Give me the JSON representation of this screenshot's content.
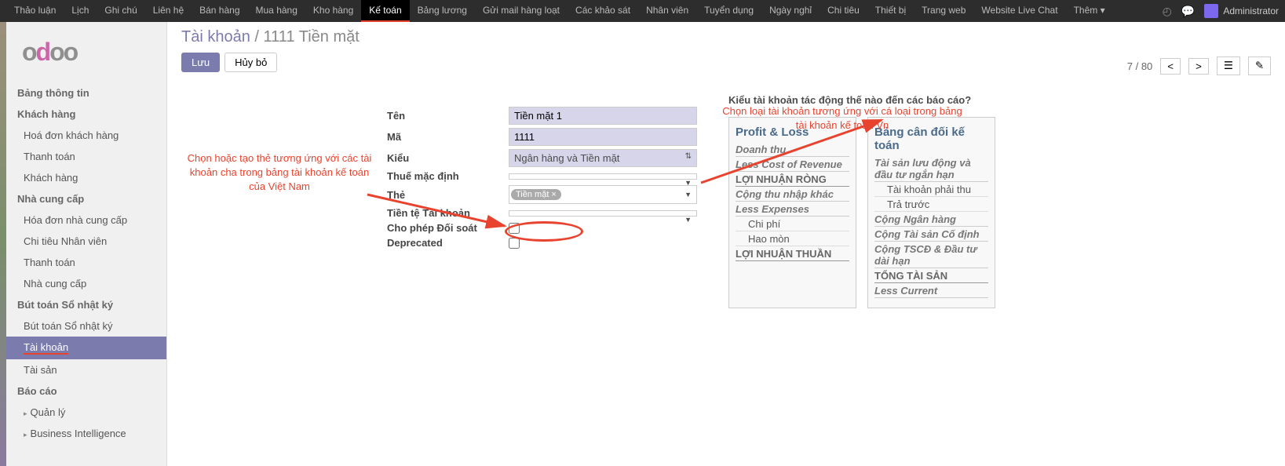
{
  "topbar": {
    "items": [
      "Thảo luận",
      "Lịch",
      "Ghi chú",
      "Liên hệ",
      "Bán hàng",
      "Mua hàng",
      "Kho hàng",
      "Kế toán",
      "Bảng lương",
      "Gửi mail hàng loạt",
      "Các khảo sát",
      "Nhân viên",
      "Tuyển dụng",
      "Ngày nghỉ",
      "Chi tiêu",
      "Thiết bị",
      "Trang web",
      "Website Live Chat",
      "Thêm"
    ],
    "active_index": 7,
    "user": "Administrator"
  },
  "sidebar": {
    "sections": [
      {
        "title": "Bảng thông tin",
        "items": []
      },
      {
        "title": "Khách hàng",
        "items": [
          "Hoá đơn khách hàng",
          "Thanh toán",
          "Khách hàng"
        ]
      },
      {
        "title": "Nhà cung cấp",
        "items": [
          "Hóa đơn nhà cung cấp",
          "Chi tiêu Nhân viên",
          "Thanh toán",
          "Nhà cung cấp"
        ]
      },
      {
        "title": "Bút toán Sổ nhật ký",
        "items": [
          "Bút toán Sổ nhật ký",
          "Tài khoản",
          "Tài sản"
        ],
        "active_index": 1
      },
      {
        "title": "Báo cáo",
        "items": [
          "Quản lý",
          "Business Intelligence"
        ],
        "collapsible": true
      }
    ]
  },
  "breadcrumb": {
    "root": "Tài khoản",
    "current": "1111 Tiền mặt"
  },
  "buttons": {
    "save": "Lưu",
    "cancel": "Hủy bỏ"
  },
  "pager": {
    "current": "7",
    "total": "80"
  },
  "form": {
    "labels": {
      "name": "Tên",
      "code": "Mã",
      "type": "Kiểu",
      "tax": "Thuế mặc định",
      "tag": "Thẻ",
      "currency": "Tiền tệ Tài khoản",
      "reconcile": "Cho phép Đối soát",
      "deprecated": "Deprecated"
    },
    "values": {
      "name": "Tiền mặt 1",
      "code": "1111",
      "type": "Ngân hàng và Tiền mặt",
      "tag": "Tiền mặt"
    }
  },
  "info": {
    "title": "Kiểu tài khoản tác động thế nào đến các báo cáo?",
    "col1": {
      "title": "Profit & Loss",
      "lines": [
        {
          "t": "Doanh thu",
          "c": "italic"
        },
        {
          "t": "Less Cost of Revenue",
          "c": "italic"
        },
        {
          "t": "LỢI NHUẬN RÒNG",
          "c": "bold"
        },
        {
          "t": "Cộng thu nhập khác",
          "c": "italic"
        },
        {
          "t": "Less Expenses",
          "c": "italic"
        },
        {
          "t": "Chi phí",
          "c": "indent"
        },
        {
          "t": "Hao mòn",
          "c": "indent"
        },
        {
          "t": "LỢI NHUẬN THUẦN",
          "c": "bold"
        }
      ]
    },
    "col2": {
      "title": "Bảng cân đối kế toán",
      "lines": [
        {
          "t": "Tài sản lưu động và đầu tư ngắn hạn",
          "c": "italic"
        },
        {
          "t": "Tài khoản phải thu",
          "c": "indent"
        },
        {
          "t": "Trả trước",
          "c": "indent"
        },
        {
          "t": "Cộng Ngân hàng",
          "c": "italic"
        },
        {
          "t": "Cộng Tài sản Cố định",
          "c": "italic"
        },
        {
          "t": "Cộng TSCĐ & Đầu tư dài hạn",
          "c": "italic"
        },
        {
          "t": "TỔNG TÀI SẢN",
          "c": "bold"
        },
        {
          "t": "Less Current",
          "c": "italic"
        }
      ]
    }
  },
  "annotations": {
    "left": "Chọn hoặc tạo thẻ tương ứng với các tài khoản cha trong bảng tài khoản kế toán của Việt Nam",
    "right": "Chọn loại tài khoản tương ứng với cá loại trong bảng tài khoản kế toán Vn"
  }
}
